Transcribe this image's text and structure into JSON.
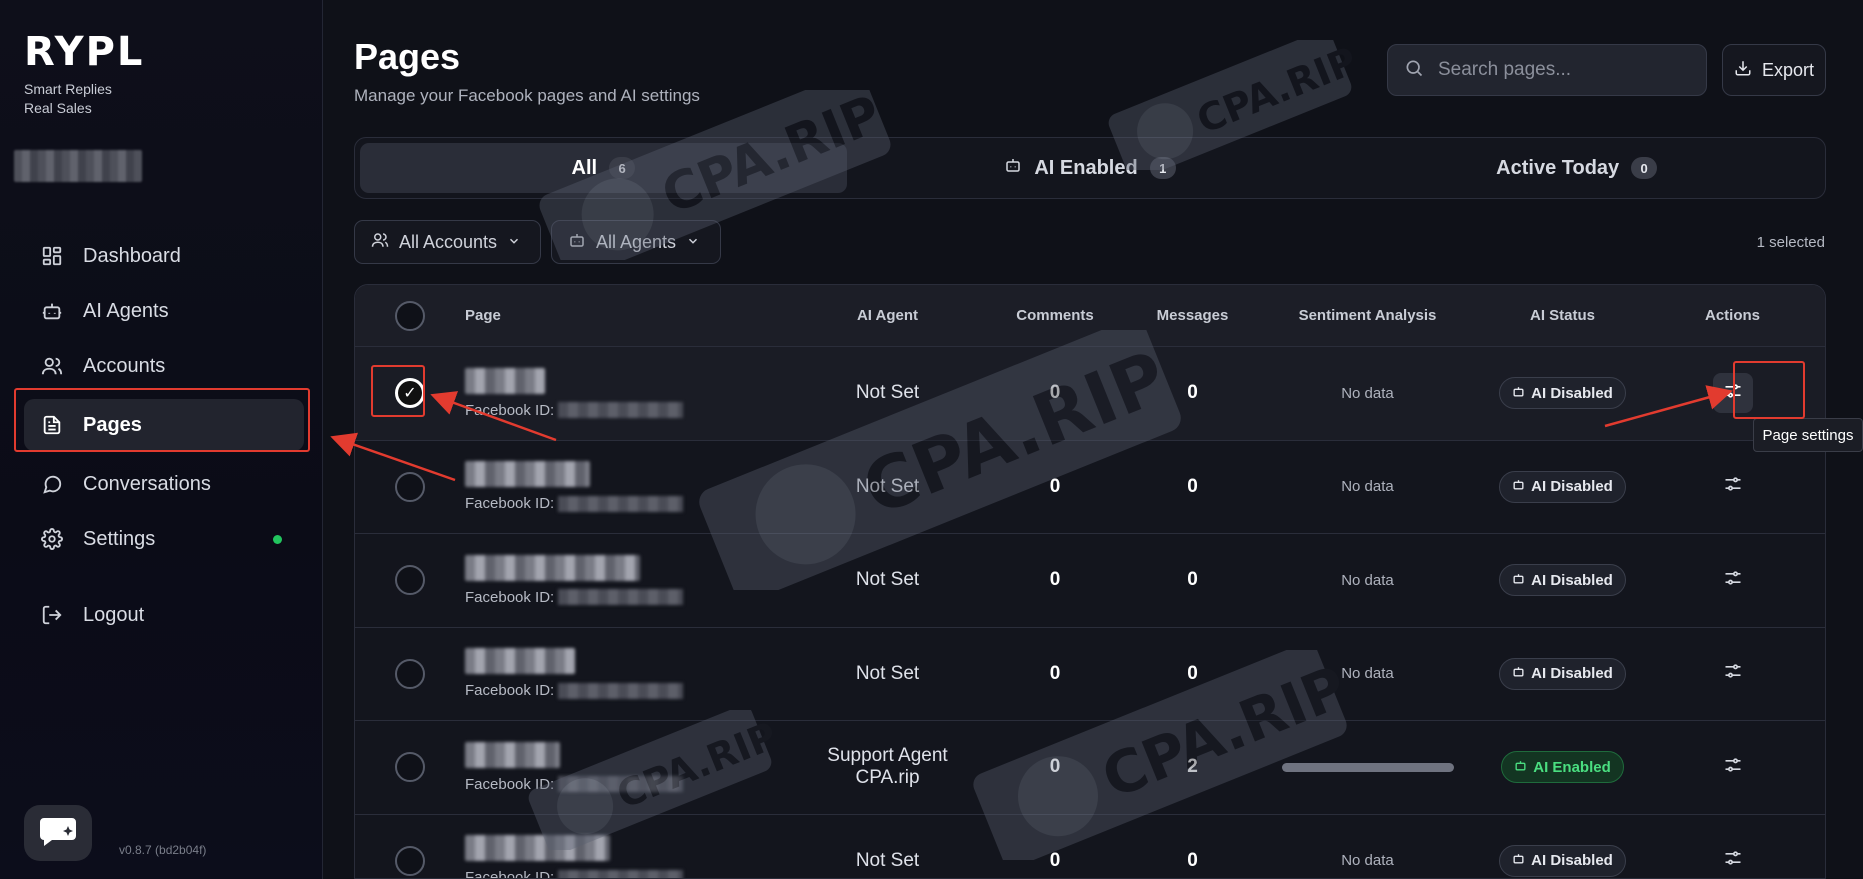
{
  "sidebar": {
    "logo": "RYPL",
    "tagline_line1": "Smart Replies",
    "tagline_line2": "Real Sales",
    "nav": [
      {
        "label": "Dashboard",
        "icon": "grid-icon"
      },
      {
        "label": "AI Agents",
        "icon": "robot-icon"
      },
      {
        "label": "Accounts",
        "icon": "users-icon"
      },
      {
        "label": "Pages",
        "icon": "document-icon",
        "active": true
      },
      {
        "label": "Conversations",
        "icon": "chat-bubble-icon"
      },
      {
        "label": "Settings",
        "icon": "gear-icon",
        "status_dot": "#22c55e"
      }
    ],
    "logout_label": "Logout",
    "version": "v0.8.7 (bd2b04f)"
  },
  "header": {
    "title": "Pages",
    "subtitle": "Manage your Facebook pages and AI settings",
    "search_placeholder": "Search pages...",
    "export_label": "Export"
  },
  "tabs": [
    {
      "label": "All",
      "count": "6",
      "active": true
    },
    {
      "label": "AI Enabled",
      "count": "1"
    },
    {
      "label": "Active Today",
      "count": "0"
    }
  ],
  "filters": {
    "accounts_label": "All Accounts",
    "agents_label": "All Agents",
    "selected_count": "1 selected"
  },
  "table": {
    "headers": {
      "page": "Page",
      "agent": "AI Agent",
      "comments": "Comments",
      "messages": "Messages",
      "sentiment": "Sentiment Analysis",
      "status": "AI Status",
      "actions": "Actions"
    },
    "fb_id_label": "Facebook ID:",
    "rows": [
      {
        "agent": "Not Set",
        "comments": "0",
        "messages": "0",
        "sentiment": "No data",
        "status": "AI Disabled",
        "selected": true
      },
      {
        "agent": "Not Set",
        "comments": "0",
        "messages": "0",
        "sentiment": "No data",
        "status": "AI Disabled"
      },
      {
        "agent": "Not Set",
        "comments": "0",
        "messages": "0",
        "sentiment": "No data",
        "status": "AI Disabled"
      },
      {
        "agent": "Not Set",
        "comments": "0",
        "messages": "0",
        "sentiment": "No data",
        "status": "AI Disabled"
      },
      {
        "agent": "Support Agent CPA.rip",
        "comments": "0",
        "messages": "2",
        "sentiment": "",
        "status": "AI Enabled"
      },
      {
        "agent": "Not Set",
        "comments": "0",
        "messages": "0",
        "sentiment": "No data",
        "status": "AI Disabled"
      }
    ]
  },
  "tooltip": "Page settings",
  "watermark_text": "CPA.RIP",
  "colors": {
    "accent_green": "#22c55e",
    "annotation_red": "#e23b2f",
    "status_enabled": "#4ade80"
  }
}
